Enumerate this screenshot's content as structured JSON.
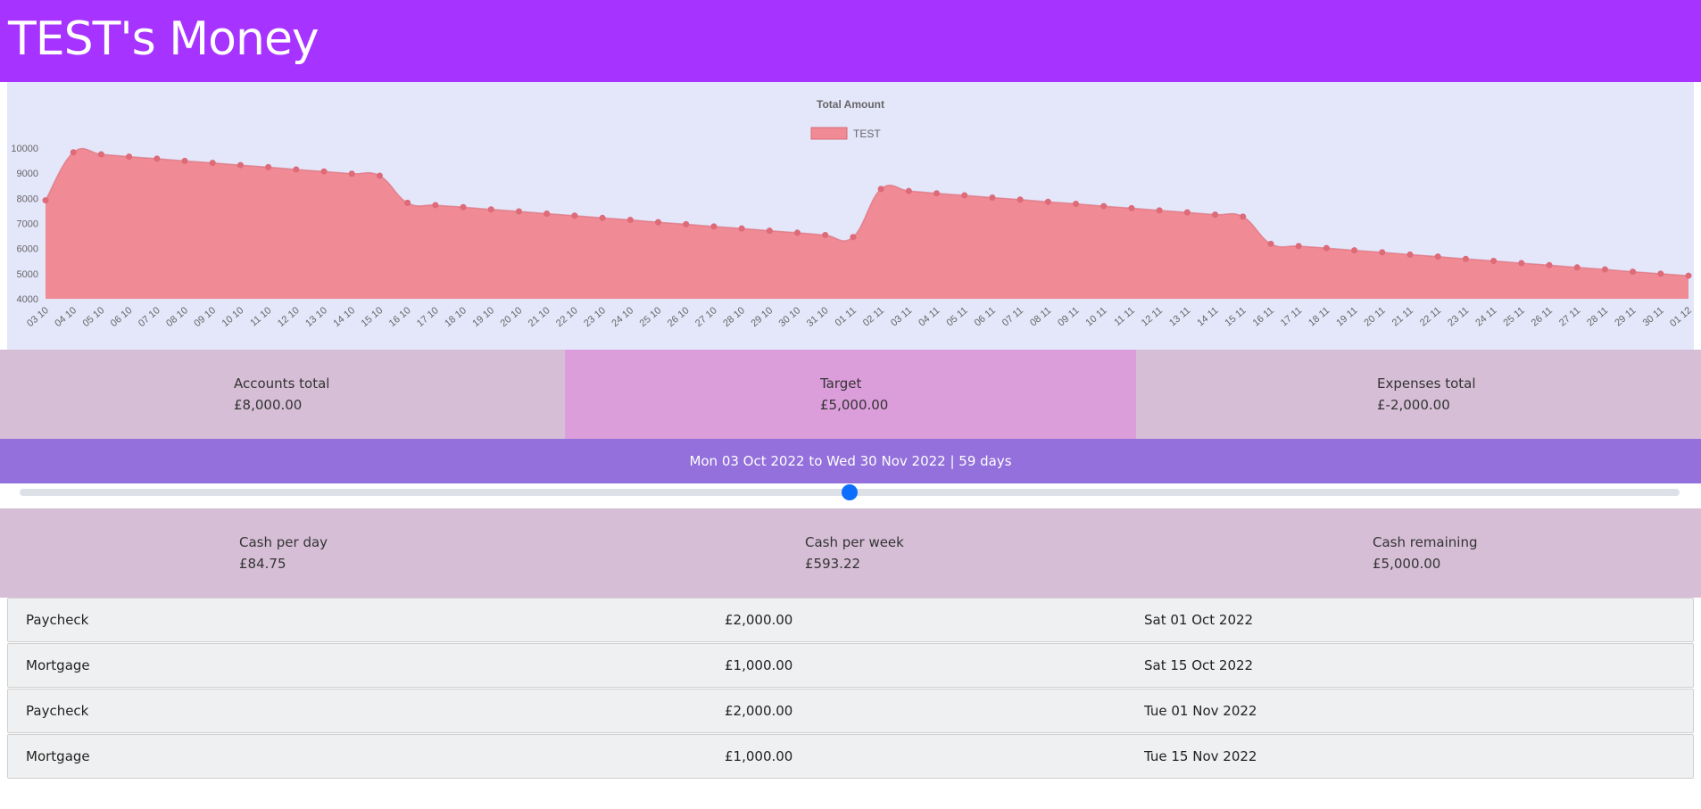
{
  "header": {
    "title": "TEST's Money"
  },
  "summary_top": {
    "accounts_label": "Accounts total",
    "accounts_value": "£8,000.00",
    "target_label": "Target",
    "target_value": "£5,000.00",
    "expenses_label": "Expenses total",
    "expenses_value": "£-2,000.00"
  },
  "date_range": {
    "text": "Mon 03 Oct 2022 to Wed 30 Nov 2022 | 59 days"
  },
  "slider": {
    "position_fraction": 0.5
  },
  "summary_bottom": {
    "per_day_label": "Cash per day",
    "per_day_value": "£84.75",
    "per_week_label": "Cash per week",
    "per_week_value": "£593.22",
    "remaining_label": "Cash remaining",
    "remaining_value": "£5,000.00"
  },
  "transactions": [
    {
      "name": "Paycheck",
      "amount": "£2,000.00",
      "date": "Sat 01 Oct 2022"
    },
    {
      "name": "Mortgage",
      "amount": "£1,000.00",
      "date": "Sat 15 Oct 2022"
    },
    {
      "name": "Paycheck",
      "amount": "£2,000.00",
      "date": "Tue 01 Nov 2022"
    },
    {
      "name": "Mortgage",
      "amount": "£1,000.00",
      "date": "Tue 15 Nov 2022"
    }
  ],
  "colors": {
    "header": "#a633ff",
    "range_bar": "#9370db",
    "series_fill": "#f08a94",
    "series_line": "#d96b78",
    "chart_bg": "#e4e6fa"
  },
  "chart_data": {
    "type": "area",
    "title": "Total Amount",
    "legend": "TEST",
    "legend_position": "top",
    "ylim": [
      4000,
      10000
    ],
    "yticks": [
      4000,
      5000,
      6000,
      7000,
      8000,
      9000,
      10000
    ],
    "categories": [
      "03 10",
      "04 10",
      "05 10",
      "06 10",
      "07 10",
      "08 10",
      "09 10",
      "10 10",
      "11 10",
      "12 10",
      "13 10",
      "14 10",
      "15 10",
      "16 10",
      "17 10",
      "18 10",
      "19 10",
      "20 10",
      "21 10",
      "22 10",
      "23 10",
      "24 10",
      "25 10",
      "26 10",
      "27 10",
      "28 10",
      "29 10",
      "30 10",
      "31 10",
      "01 11",
      "02 11",
      "03 11",
      "04 11",
      "05 11",
      "06 11",
      "07 11",
      "08 11",
      "09 11",
      "10 11",
      "11 11",
      "12 11",
      "13 11",
      "14 11",
      "15 11",
      "16 11",
      "17 11",
      "18 11",
      "19 11",
      "20 11",
      "21 11",
      "22 11",
      "23 11",
      "24 11",
      "25 11",
      "26 11",
      "27 11",
      "28 11",
      "29 11",
      "30 11",
      "01 12"
    ],
    "series": [
      {
        "name": "TEST",
        "values": [
          7920,
          9830,
          9750,
          9660,
          9580,
          9490,
          9410,
          9320,
          9240,
          9150,
          9070,
          8980,
          8900,
          7820,
          7730,
          7650,
          7560,
          7480,
          7390,
          7310,
          7220,
          7140,
          7050,
          6970,
          6880,
          6800,
          6710,
          6630,
          6540,
          6460,
          8370,
          8290,
          8200,
          8120,
          8030,
          7950,
          7860,
          7780,
          7690,
          7610,
          7520,
          7440,
          7350,
          7270,
          6190,
          6100,
          6020,
          5930,
          5850,
          5760,
          5680,
          5590,
          5510,
          5420,
          5340,
          5250,
          5170,
          5080,
          5000,
          4920
        ]
      }
    ]
  }
}
